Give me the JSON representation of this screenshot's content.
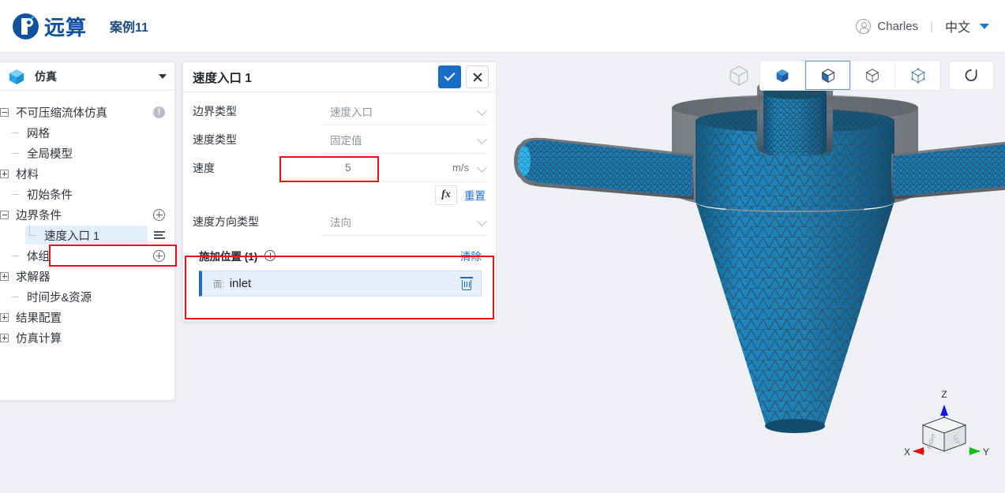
{
  "topbar": {
    "brand_name": "远算",
    "brand_icon": "yuansuan-logo-icon",
    "doc_title": "案例11",
    "user_icon": "avatar-icon",
    "user_name": "Charles",
    "separator": "|",
    "language": "中文",
    "lang_caret_icon": "chevron-down-icon"
  },
  "sidebar": {
    "header": {
      "icon": "blue-cube-icon",
      "title": "仿真",
      "caret_icon": "chevron-down-icon"
    },
    "tree": [
      {
        "label": "不可压缩流体仿真",
        "level": 0,
        "toggle": "minus",
        "badge": "!",
        "name": "sidebar-item-incompressible-flow"
      },
      {
        "label": "网格",
        "level": 1,
        "toggle": "stub",
        "name": "sidebar-item-mesh"
      },
      {
        "label": "全局模型",
        "level": 1,
        "toggle": "stub",
        "name": "sidebar-item-global-model"
      },
      {
        "label": "材料",
        "level": 0,
        "toggle": "plus",
        "name": "sidebar-item-material"
      },
      {
        "label": "初始条件",
        "level": 1,
        "toggle": "stub",
        "name": "sidebar-item-initial-conditions"
      },
      {
        "label": "边界条件",
        "level": 0,
        "toggle": "minus",
        "action": "plus-circle",
        "name": "sidebar-item-boundary-conditions"
      },
      {
        "label": "速度入口 1",
        "level": 2,
        "toggle": "elbow",
        "selected": true,
        "action": "menu-lines",
        "name": "sidebar-item-velocity-inlet-1"
      },
      {
        "label": "体组",
        "level": 1,
        "toggle": "stub",
        "action": "plus-circle",
        "name": "sidebar-item-volume-group"
      },
      {
        "label": "求解器",
        "level": 0,
        "toggle": "plus",
        "name": "sidebar-item-solver"
      },
      {
        "label": "时间步&资源",
        "level": 1,
        "toggle": "stub",
        "name": "sidebar-item-timestep-resources"
      },
      {
        "label": "结果配置",
        "level": 0,
        "toggle": "plus",
        "name": "sidebar-item-result-config"
      },
      {
        "label": "仿真计算",
        "level": 0,
        "toggle": "plus",
        "name": "sidebar-item-simulation-run"
      }
    ]
  },
  "panel": {
    "title": "速度入口 1",
    "confirm_icon": "check-icon",
    "cancel_icon": "close-icon",
    "fields": [
      {
        "label": "边界类型",
        "value": "速度入口",
        "unit": "",
        "name": "boundary-type"
      },
      {
        "label": "速度类型",
        "value": "固定值",
        "unit": "",
        "name": "velocity-type"
      },
      {
        "label": "速度",
        "value": "5",
        "unit": "m/s",
        "name": "velocity-value",
        "highlighted": true
      },
      {
        "label": "速度方向类型",
        "value": "法向",
        "unit": "",
        "name": "velocity-direction-type"
      }
    ],
    "fx_label": "fx",
    "reset_label": "重置",
    "location": {
      "title": "施加位置 (1)",
      "add_icon": "plus-circle-icon",
      "clear_label": "清除",
      "item_kind": "面:",
      "item_name": "inlet",
      "delete_icon": "trash-icon"
    }
  },
  "viewport": {
    "toolbar": [
      {
        "name": "view-cube-ghost-icon",
        "state": "ghost"
      },
      {
        "name": "view-shaded-icon",
        "state": "normal"
      },
      {
        "name": "view-shaded-edges-icon",
        "state": "active"
      },
      {
        "name": "view-wireframe-icon",
        "state": "normal"
      },
      {
        "name": "view-points-icon",
        "state": "normal"
      },
      {
        "name": "view-reset-icon",
        "state": "normal"
      }
    ],
    "axes": {
      "x": "X",
      "y": "Y",
      "z": "Z",
      "face_right": "RIGHT",
      "face_left": "LEFT"
    },
    "model": "cyclone-separator-mesh"
  },
  "colors": {
    "accent_blue": "#1a6dc4",
    "link_blue": "#1f6fd0",
    "brand_blue": "#0f52a0",
    "highlight_red": "#ee1010",
    "mesh_blue": "#1a7bb5",
    "selected_face_cyan": "#2fb8f5",
    "viewport_bg": "#eef0f4"
  }
}
